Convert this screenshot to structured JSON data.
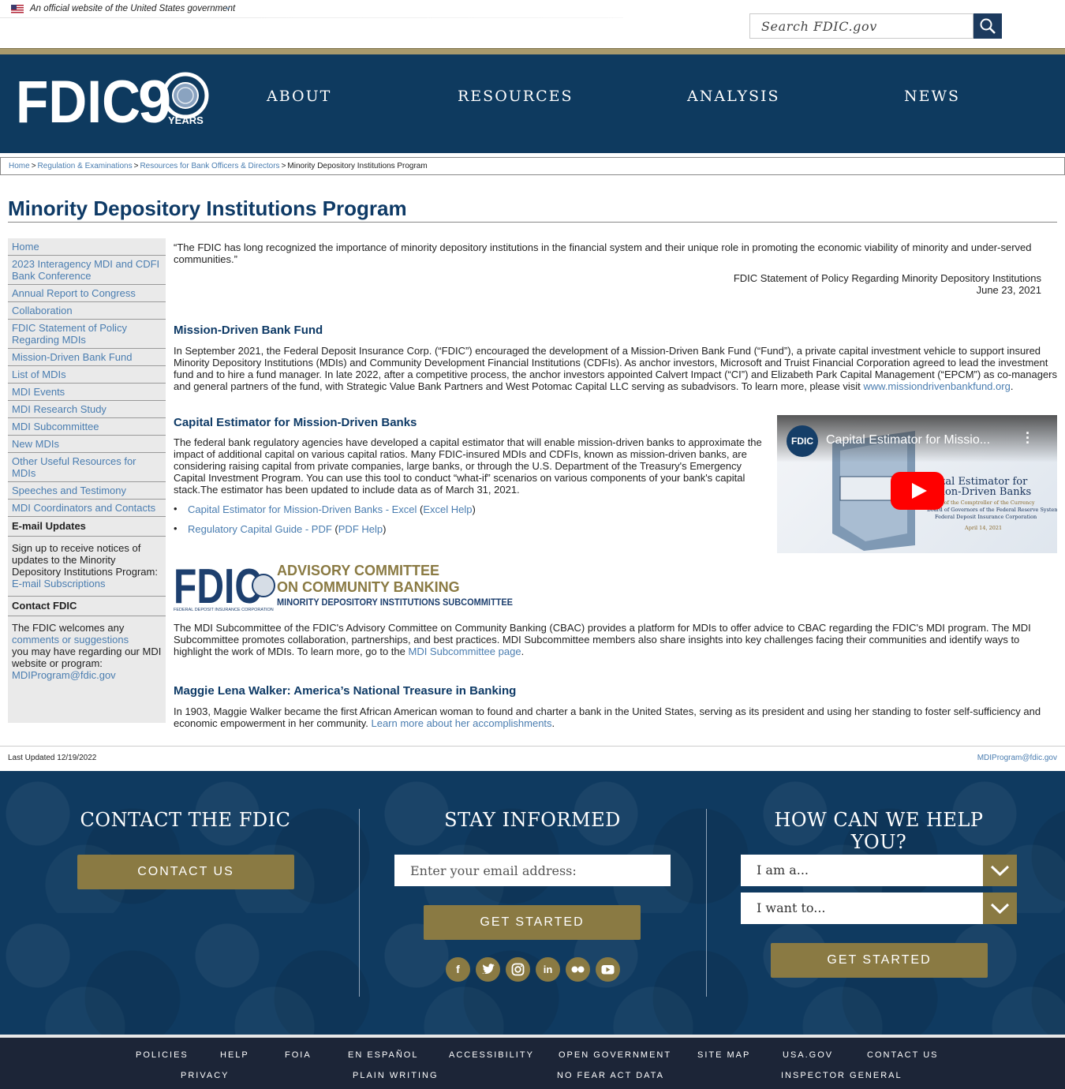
{
  "gov_banner": {
    "text": "An official website of the United States government"
  },
  "search": {
    "placeholder": "Search FDIC.gov"
  },
  "logo": {
    "text": "FDIC",
    "anniversary": "9",
    "years": "YEARS"
  },
  "nav": [
    "ABOUT",
    "RESOURCES",
    "ANALYSIS",
    "NEWS"
  ],
  "breadcrumb": [
    "Home",
    "Regulation & Examinations",
    "Resources for Bank Officers & Directors",
    "Minority Depository Institutions Program"
  ],
  "page_title": "Minority Depository Institutions Program",
  "sidebar": {
    "links": [
      "Home",
      "2023 Interagency MDI and CDFI Bank Conference",
      "Annual Report to Congress",
      "Collaboration",
      "FDIC Statement of Policy Regarding MDIs",
      "Mission-Driven Bank Fund",
      "List of MDIs",
      "MDI Events",
      "MDI Research Study",
      "MDI Subcommittee",
      "New MDIs",
      "Other Useful Resources for MDIs",
      "Speeches and Testimony",
      "MDI Coordinators and Contacts"
    ],
    "email_heading": "E-mail Updates",
    "email_text": "Sign up to receive notices of updates to the Minority Depository Institutions Program:",
    "email_link": "E-mail Subscriptions",
    "contact_heading": "Contact FDIC",
    "contact_text1": "The FDIC welcomes any",
    "contact_link": "comments or suggestions",
    "contact_text2": "you may have regarding our MDI website or program:",
    "contact_email": "MDIProgram@fdic.gov"
  },
  "quote": {
    "text": "“The FDIC has long recognized the importance of minority depository institutions in the financial system and their unique role in promoting the economic viability of minority and under-served communities.”",
    "source": "FDIC Statement of Policy Regarding Minority Depository Institutions",
    "date": "June 23, 2021"
  },
  "fund": {
    "heading": "Mission-Driven Bank Fund",
    "text": "In September 2021, the Federal Deposit Insurance Corp. (“FDIC”) encouraged the development of a Mission-Driven Bank Fund (“Fund”), a private capital investment vehicle to support insured Minority Depository Institutions (MDIs) and Community Development Financial Institutions (CDFIs). As anchor investors, Microsoft and Truist Financial Corporation agreed to lead the investment fund and to hire a fund manager. In late 2022, after a competitive process, the anchor investors appointed Calvert Impact (“CI”) and Elizabeth Park Capital Management (“EPCM”) as co-managers and general partners of the fund, with Strategic Value Bank Partners and West Potomac Capital LLC serving as subadvisors. To learn more, please visit",
    "link": "www.missiondrivenbankfund.org"
  },
  "estimator": {
    "heading": "Capital Estimator for Mission-Driven Banks",
    "text": "The federal bank regulatory agencies have developed a capital estimator that will enable mission-driven banks to approximate the impact of additional capital on various capital ratios. Many FDIC-insured MDIs and CDFIs, known as mission-driven banks, are considering raising capital from private companies, large banks, or through the U.S. Department of the Treasury's Emergency Capital Investment Program. You can use this tool to conduct “what-if” scenarios on various components of your bank's capital stack.The estimator has been updated to include data as of March 31, 2021.",
    "link1": "Capital Estimator for Mission-Driven Banks - Excel",
    "link1_help": "Excel Help",
    "link2": "Regulatory Capital Guide - PDF",
    "link2_help": "PDF Help"
  },
  "video": {
    "title": "Capital Estimator for Missio...",
    "badge": "FDIC",
    "slide_title_1": "Capital Estimator for",
    "slide_title_2": "Mission-Driven Banks",
    "slide_sub_1": "Office of the Comptroller of the Currency",
    "slide_sub_2": "Board of Governors of the Federal Reserve System",
    "slide_sub_3": "Federal Deposit Insurance Corporation",
    "slide_date": "April 14, 2021"
  },
  "cbac": {
    "logo_fdic": "FDIC",
    "logo_sub": "FEDERAL DEPOSIT INSURANCE CORPORATION",
    "logo_line1": "ADVISORY COMMITTEE",
    "logo_line2": "ON COMMUNITY BANKING",
    "logo_line3": "MINORITY DEPOSITORY INSTITUTIONS SUBCOMMITTEE",
    "text": "The MDI Subcommittee of the FDIC's Advisory Committee on Community Banking (CBAC) provides a platform for MDIs to offer advice to CBAC regarding the FDIC's MDI program. The MDI Subcommittee promotes collaboration, partnerships, and best practices. MDI Subcommittee members also share insights into key challenges facing their communities and identify ways to highlight the work of MDIs. To learn more, go to the",
    "link": "MDI Subcommittee page"
  },
  "walker": {
    "heading": "Maggie Lena Walker: America’s National Treasure in Banking",
    "text": "In 1903, Maggie Walker became the first African American woman to found and charter a bank in the United States, serving as its president and using her standing to foster self-sufficiency and economic empowerment in her community.",
    "link": "Learn more about her accomplishments"
  },
  "last_updated": "Last Updated 12/19/2022",
  "last_email": "MDIProgram@fdic.gov",
  "footer": {
    "contact_title": "CONTACT THE FDIC",
    "contact_btn": "CONTACT US",
    "informed_title": "STAY INFORMED",
    "email_placeholder": "Enter your email address:",
    "informed_btn": "GET STARTED",
    "help_title": "HOW CAN WE HELP YOU?",
    "select1": "I am a...",
    "select2": "I want to...",
    "help_btn": "GET STARTED"
  },
  "bottom_links_row1": [
    "POLICIES",
    "HELP",
    "FOIA",
    "EN ESPAÑOL",
    "ACCESSIBILITY",
    "OPEN GOVERNMENT",
    "SITE MAP",
    "USA.GOV",
    "CONTACT US"
  ],
  "bottom_links_row2": [
    "PRIVACY",
    "PLAIN WRITING",
    "NO FEAR ACT DATA",
    "INSPECTOR GENERAL"
  ],
  "colors": {
    "navy": "#0e3a5f",
    "gold": "#8a7a43",
    "link": "#4a7db0",
    "title": "#0e3a66"
  }
}
